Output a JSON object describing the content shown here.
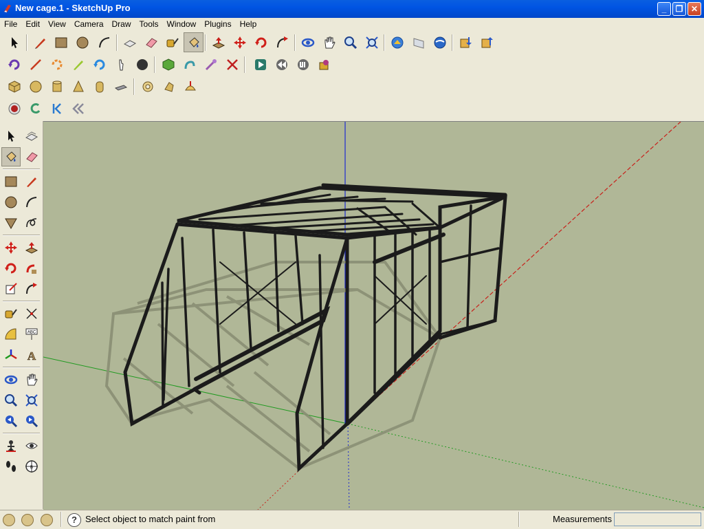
{
  "window": {
    "title": "New cage.1 - SketchUp Pro"
  },
  "menu": [
    "File",
    "Edit",
    "View",
    "Camera",
    "Draw",
    "Tools",
    "Window",
    "Plugins",
    "Help"
  ],
  "toolbars": {
    "row1": [
      "select-icon",
      "pencil-icon",
      "rectangle-icon",
      "circle-icon",
      "arc-icon",
      "make-component-icon",
      "eraser-icon",
      "tape-measure-icon",
      "paint-bucket-icon",
      "push-pull-icon",
      "move-icon",
      "rotate-icon",
      "follow-me-icon",
      "orbit-icon",
      "pan-icon",
      "zoom-icon",
      "zoom-extents-icon",
      "get-models-icon",
      "share-model-icon",
      "google-earth-icon",
      "import-icon",
      "export-icon"
    ],
    "row2": [
      "rotate-tool-icon",
      "line-tool-icon",
      "orbit-arrows-icon",
      "pencil-green-icon",
      "refresh-icon",
      "hand-icon",
      "dark-circle-icon",
      "cube-green-icon",
      "sandbox-icon",
      "wand-icon",
      "cross-icon",
      "play-icon",
      "rewind-icon",
      "ui-icon",
      "component-box-icon"
    ],
    "row3": [
      "box-icon",
      "sphere-icon",
      "cylinder-icon",
      "cone-icon",
      "tube-icon",
      "plane-icon",
      "torus-icon",
      "shape-icon",
      "dome-icon"
    ],
    "row4": [
      "record-icon",
      "loop-icon",
      "first-frame-icon",
      "previous-icon"
    ]
  },
  "left_tools": [
    "select-icon",
    "make-component-icon",
    "paint-bucket-icon",
    "eraser-icon",
    "rectangle-icon",
    "line-icon",
    "circle-icon",
    "arc-icon",
    "polygon-icon",
    "freehand-icon",
    "move-icon",
    "push-pull-icon",
    "rotate-icon",
    "follow-me-icon",
    "scale-icon",
    "offset-icon",
    "tape-measure-icon",
    "dimension-icon",
    "protractor-icon",
    "text-icon",
    "axes-icon",
    "3d-text-icon",
    "orbit-icon",
    "pan-icon",
    "zoom-icon",
    "zoom-window-icon",
    "previous-view-icon",
    "next-view-icon",
    "position-camera-icon",
    "look-around-icon",
    "walk-icon",
    "section-plane-icon"
  ],
  "status": {
    "message": "Select object to match paint from",
    "measurements_label": "Measurements",
    "measurements_value": ""
  },
  "colors": {
    "viewport_bg": "#b0b797",
    "red_axis": "#c8201a",
    "green_axis": "#1f9a1f",
    "blue_axis": "#1d2ad0",
    "frame": "#1b1b1b"
  }
}
